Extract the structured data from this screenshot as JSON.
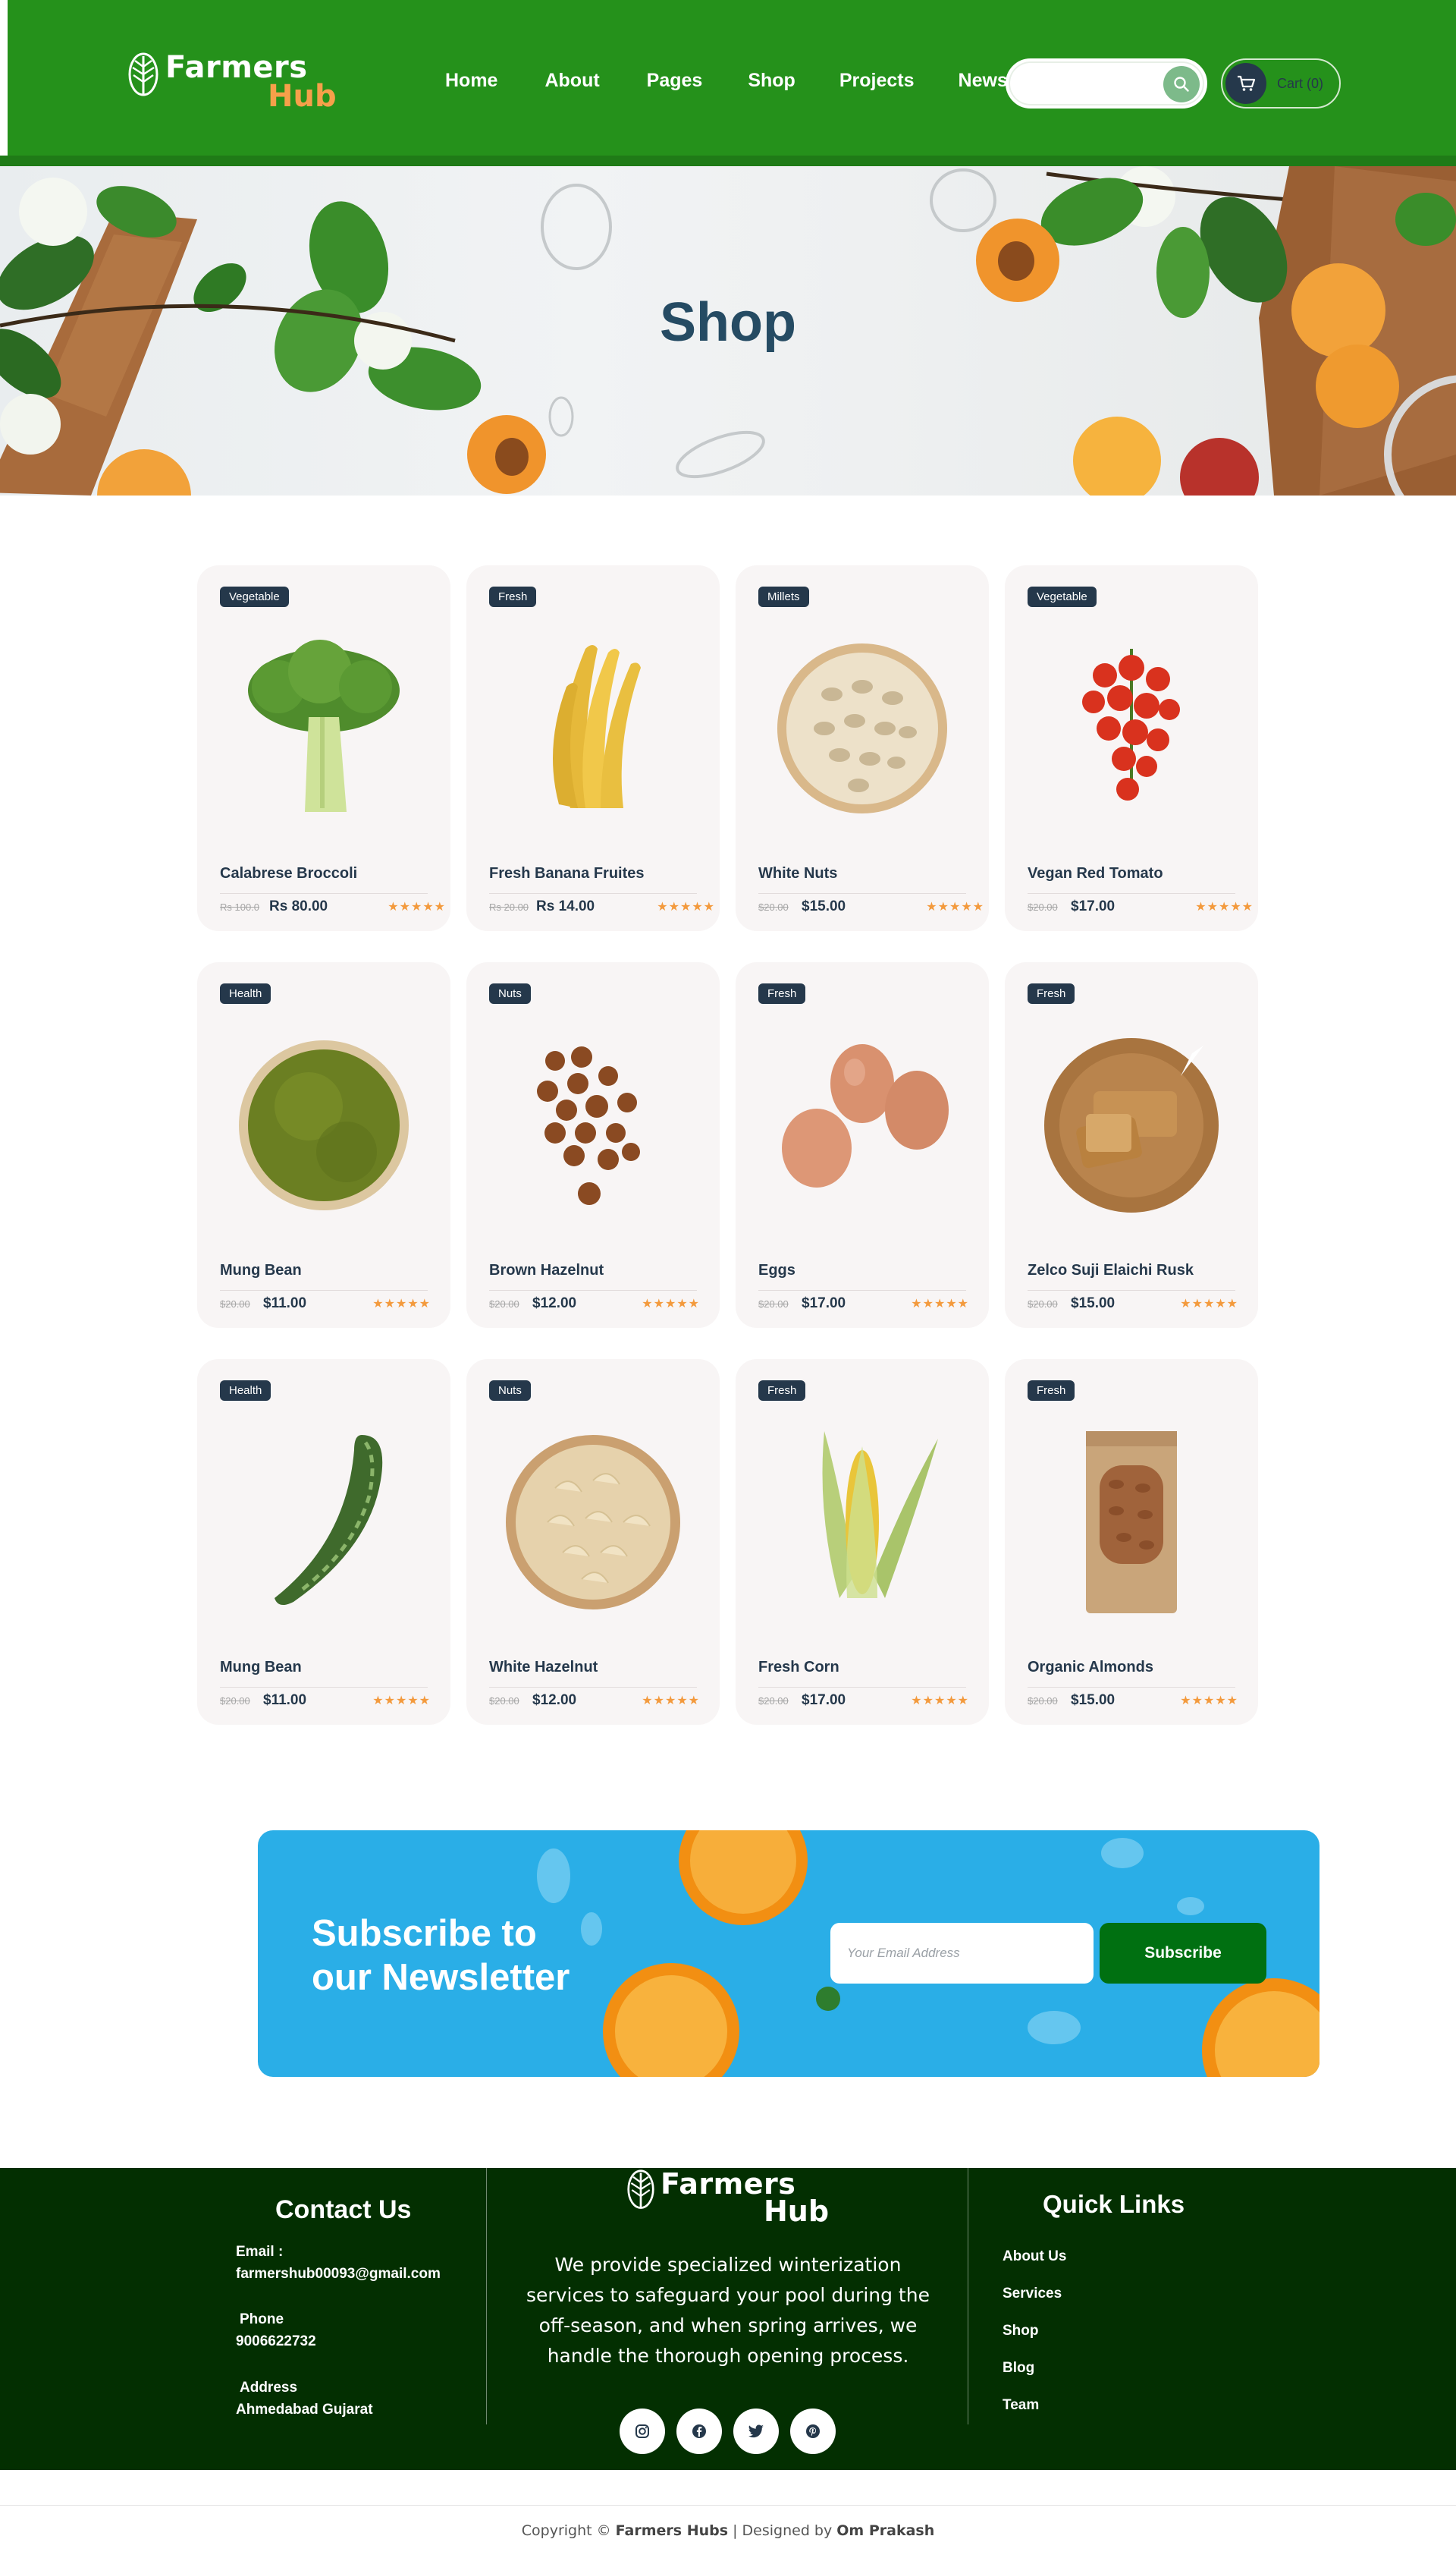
{
  "brand": {
    "name_line1": "Farmers",
    "name_line2": "Hub",
    "color_primary": "#25911b",
    "color_accent": "#f6a04a",
    "color_dark": "#25384b"
  },
  "nav": {
    "items": [
      "Home",
      "About",
      "Pages",
      "Shop",
      "Projects",
      "News"
    ]
  },
  "search": {
    "placeholder": ""
  },
  "cart": {
    "label": "Cart (0)"
  },
  "hero": {
    "title": "Shop"
  },
  "products": [
    {
      "badge": "Vegetable",
      "name": "Calabrese Broccoli",
      "old_price": "Rs 100.0",
      "price": "Rs 80.00",
      "rating": 5,
      "image": "broccoli"
    },
    {
      "badge": "Fresh",
      "name": "Fresh Banana Fruites",
      "old_price": "Rs 20.00",
      "price": "Rs 14.00",
      "rating": 5,
      "image": "banana"
    },
    {
      "badge": "Millets",
      "name": "White Nuts",
      "old_price": "$20.00",
      "price": "$15.00",
      "rating": 5,
      "image": "pistachio-bowl"
    },
    {
      "badge": "Vegetable",
      "name": "Vegan Red Tomato",
      "old_price": "$20.00",
      "price": "$17.00",
      "rating": 5,
      "image": "cherry-tomatoes"
    },
    {
      "badge": "Health",
      "name": "Mung Bean",
      "old_price": "$20.00",
      "price": "$11.00",
      "rating": 5,
      "image": "mung-bean-bowl"
    },
    {
      "badge": "Nuts",
      "name": "Brown Hazelnut",
      "old_price": "$20.00",
      "price": "$12.00",
      "rating": 5,
      "image": "hazelnuts"
    },
    {
      "badge": "Fresh",
      "name": "Eggs",
      "old_price": "$20.00",
      "price": "$17.00",
      "rating": 5,
      "image": "eggs"
    },
    {
      "badge": "Fresh",
      "name": "Zelco Suji Elaichi Rusk",
      "old_price": "$20.00",
      "price": "$15.00",
      "rating": 5,
      "image": "rusk-board"
    },
    {
      "badge": "Health",
      "name": "Mung Bean",
      "old_price": "$20.00",
      "price": "$11.00",
      "rating": 5,
      "image": "cucumber"
    },
    {
      "badge": "Nuts",
      "name": "White Hazelnut",
      "old_price": "$20.00",
      "price": "$12.00",
      "rating": 5,
      "image": "cashew-bowl"
    },
    {
      "badge": "Fresh",
      "name": "Fresh Corn",
      "old_price": "$20.00",
      "price": "$17.00",
      "rating": 5,
      "image": "corn"
    },
    {
      "badge": "Fresh",
      "name": "Organic Almonds",
      "old_price": "$20.00",
      "price": "$15.00",
      "rating": 5,
      "image": "almond-pouch"
    }
  ],
  "newsletter": {
    "title_line1": "Subscribe to",
    "title_line2": "our Newsletter",
    "input_placeholder": "Your Email Address",
    "button_label": "Subscribe"
  },
  "footer": {
    "contact_title": "Contact Us",
    "email_label": "Email :",
    "email_value": "farmershub00093@gmail.com",
    "phone_label": "Phone",
    "phone_value": "9006622732",
    "address_label": "Address",
    "address_value": "Ahmedabad Gujarat",
    "description": "We provide specialized winterization services to safeguard your pool during the off-season, and when spring arrives, we handle the thorough opening process.",
    "socials": [
      "instagram-icon",
      "facebook-icon",
      "twitter-icon",
      "pinterest-icon"
    ],
    "quick_links_title": "Quick Links",
    "quick_links": [
      "About Us",
      "Services",
      "Shop",
      "Blog",
      "Team"
    ]
  },
  "copyright": {
    "prefix": "Copyright © ",
    "brand": "Farmers Hubs",
    "middle": " | Designed by ",
    "designer": "Om Prakash"
  }
}
